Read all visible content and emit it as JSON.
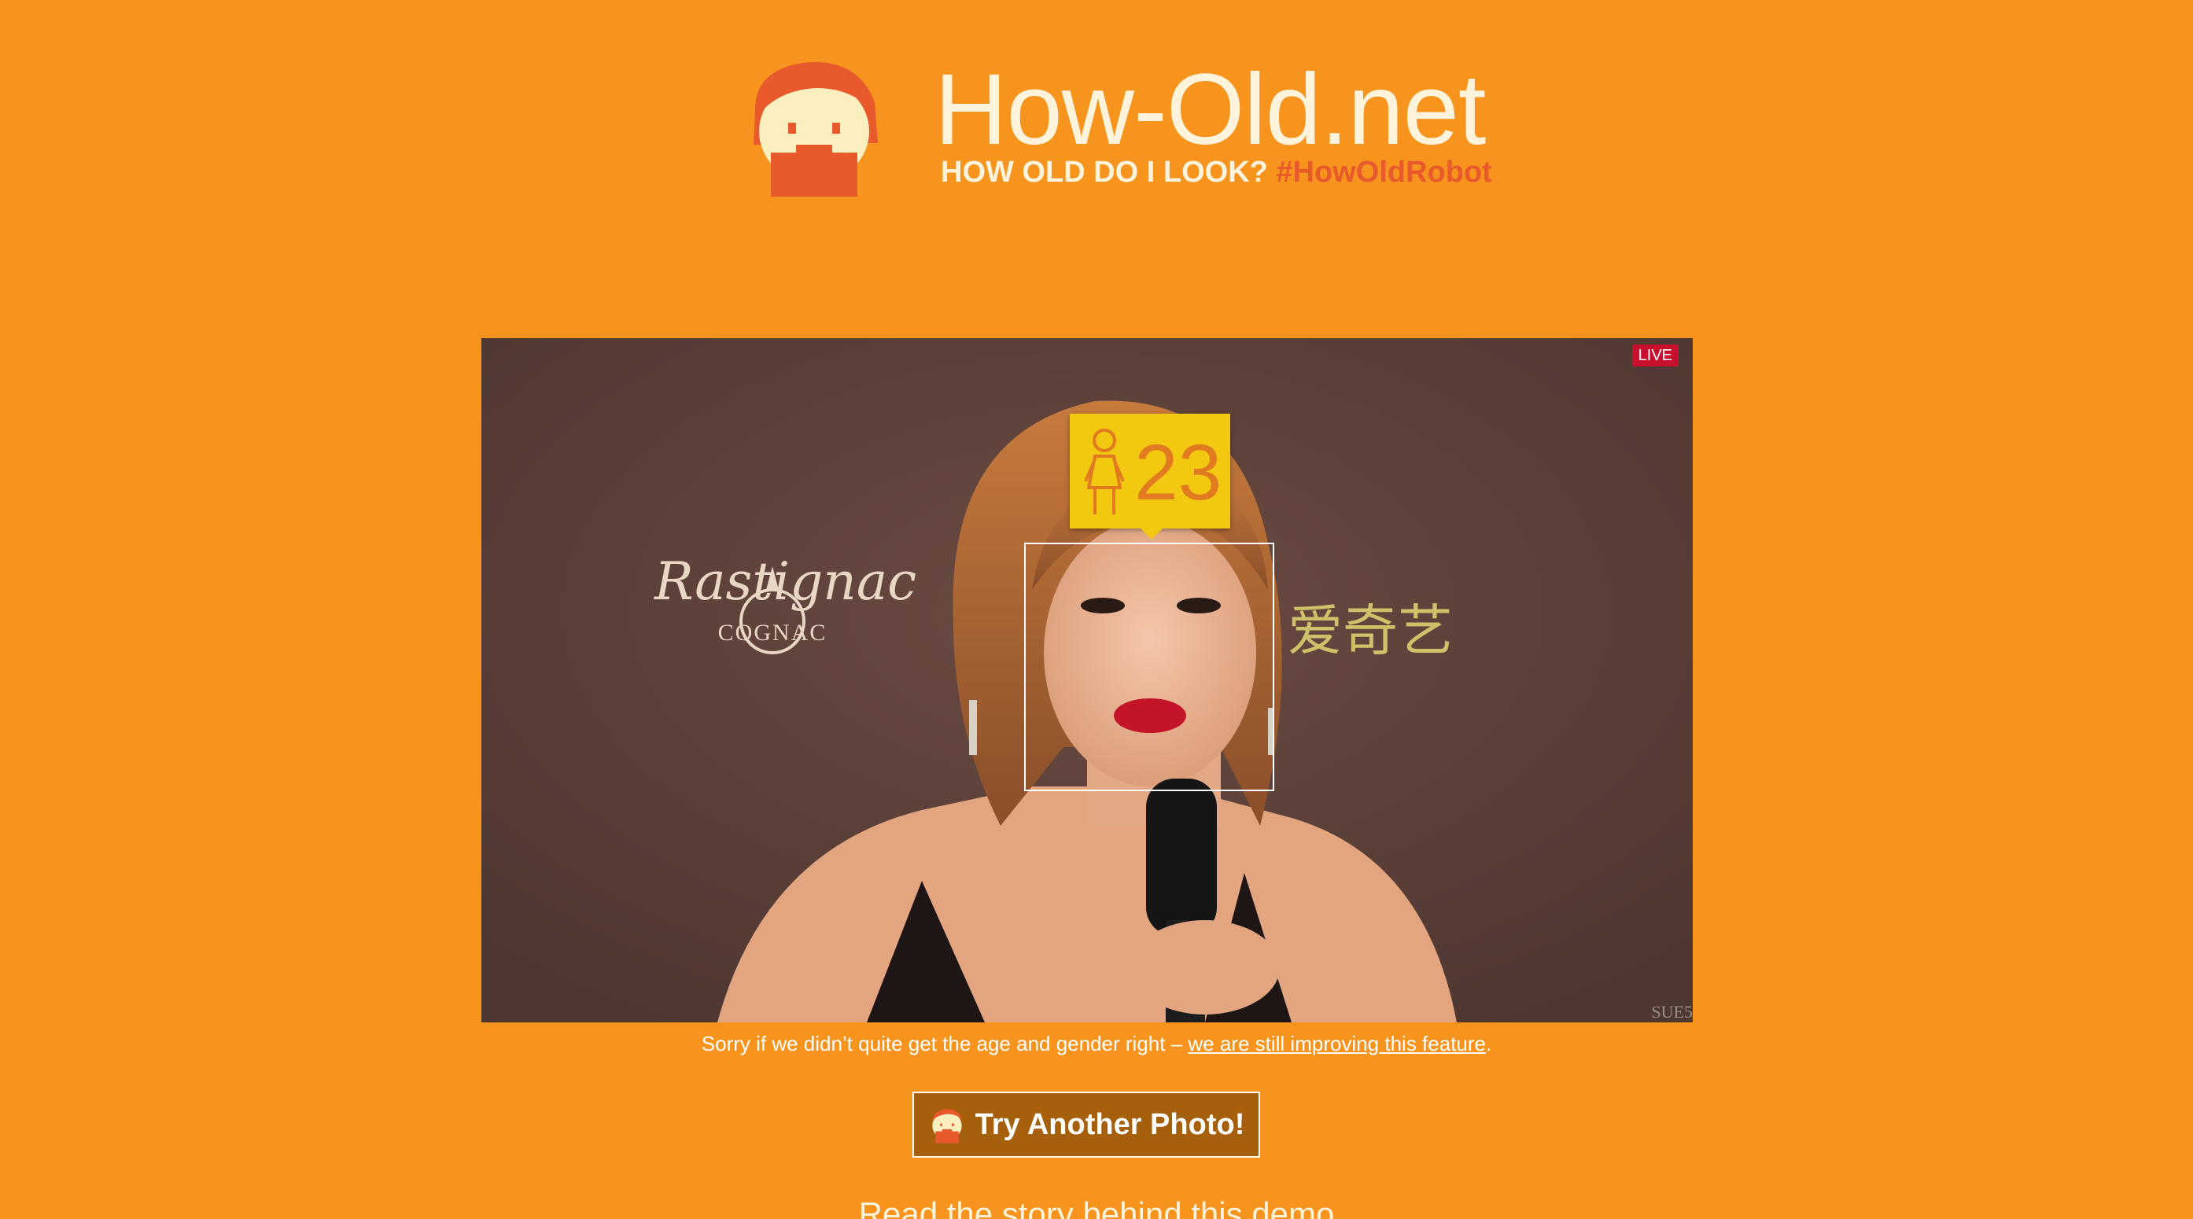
{
  "header": {
    "title": "How-Old.net",
    "subtitle": "HOW OLD DO I LOOK?",
    "hashtag": "#HowOldRobot"
  },
  "photo": {
    "live_label": "LIVE",
    "result": {
      "gender_icon": "female-icon",
      "age": "23"
    },
    "watermark_brand": "Rastignac",
    "watermark_brand_sub": "COGNAC",
    "watermark_cn": "爱奇艺",
    "corner_mark": "SUE5"
  },
  "disclaimer": {
    "text": "Sorry if we didn’t quite get the age and gender right – ",
    "link": "we are still improving this feature",
    "end": "."
  },
  "try_button": {
    "label": "Try Another Photo!",
    "icon": "mascot-icon"
  },
  "read_story": "Read the story behind this demo",
  "colors": {
    "background": "#f7941e",
    "accent": "#e8592b",
    "tag": "#f2c811",
    "button": "#a65f0b"
  }
}
